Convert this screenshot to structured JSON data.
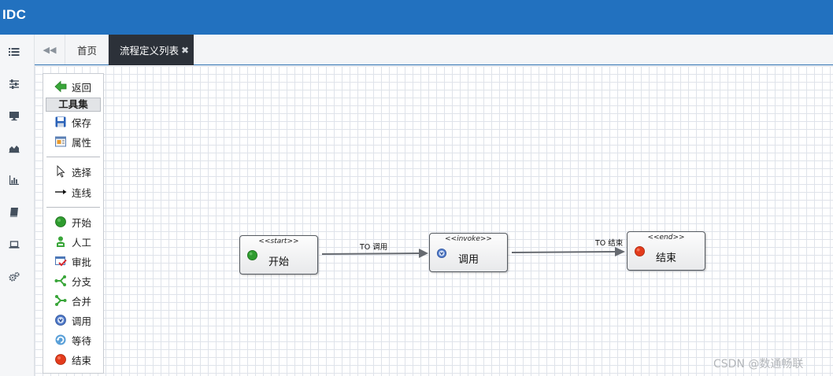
{
  "app": {
    "title": "IDC"
  },
  "left_nav": {
    "items": [
      {
        "icon": "list-icon"
      },
      {
        "icon": "sliders-icon"
      },
      {
        "icon": "monitor-icon"
      },
      {
        "icon": "area-chart-icon"
      },
      {
        "icon": "bar-chart-icon"
      },
      {
        "icon": "book-icon"
      },
      {
        "icon": "laptop-icon"
      },
      {
        "icon": "gears-icon"
      }
    ]
  },
  "tabs": {
    "back_icon": "double-chevron-left-icon",
    "home": "首页",
    "active": "流程定义列表",
    "close_glyph": "✖"
  },
  "toolbox": {
    "back": "返回",
    "toolset_title": "工具集",
    "save": "保存",
    "properties": "属性",
    "select": "选择",
    "connect": "连线",
    "start": "开始",
    "manual": "人工",
    "approve": "审批",
    "branch": "分支",
    "merge": "合并",
    "invoke": "调用",
    "wait": "等待",
    "end": "结束"
  },
  "diagram": {
    "nodes": {
      "start": {
        "stereotype": "<<start>>",
        "label": "开始"
      },
      "invoke": {
        "stereotype": "<<invoke>>",
        "label": "调用"
      },
      "end": {
        "stereotype": "<<end>>",
        "label": "结束"
      }
    },
    "edges": {
      "start_to_invoke": "TO 调用",
      "invoke_to_end": "TO 结束"
    }
  },
  "watermark": "CSDN @数通畅联",
  "colors": {
    "header": "#2271bf",
    "active_tab": "#2c3139",
    "start_node": "#2e9b2e",
    "end_node": "#e33b1c",
    "grid": "#dfe3ea"
  }
}
